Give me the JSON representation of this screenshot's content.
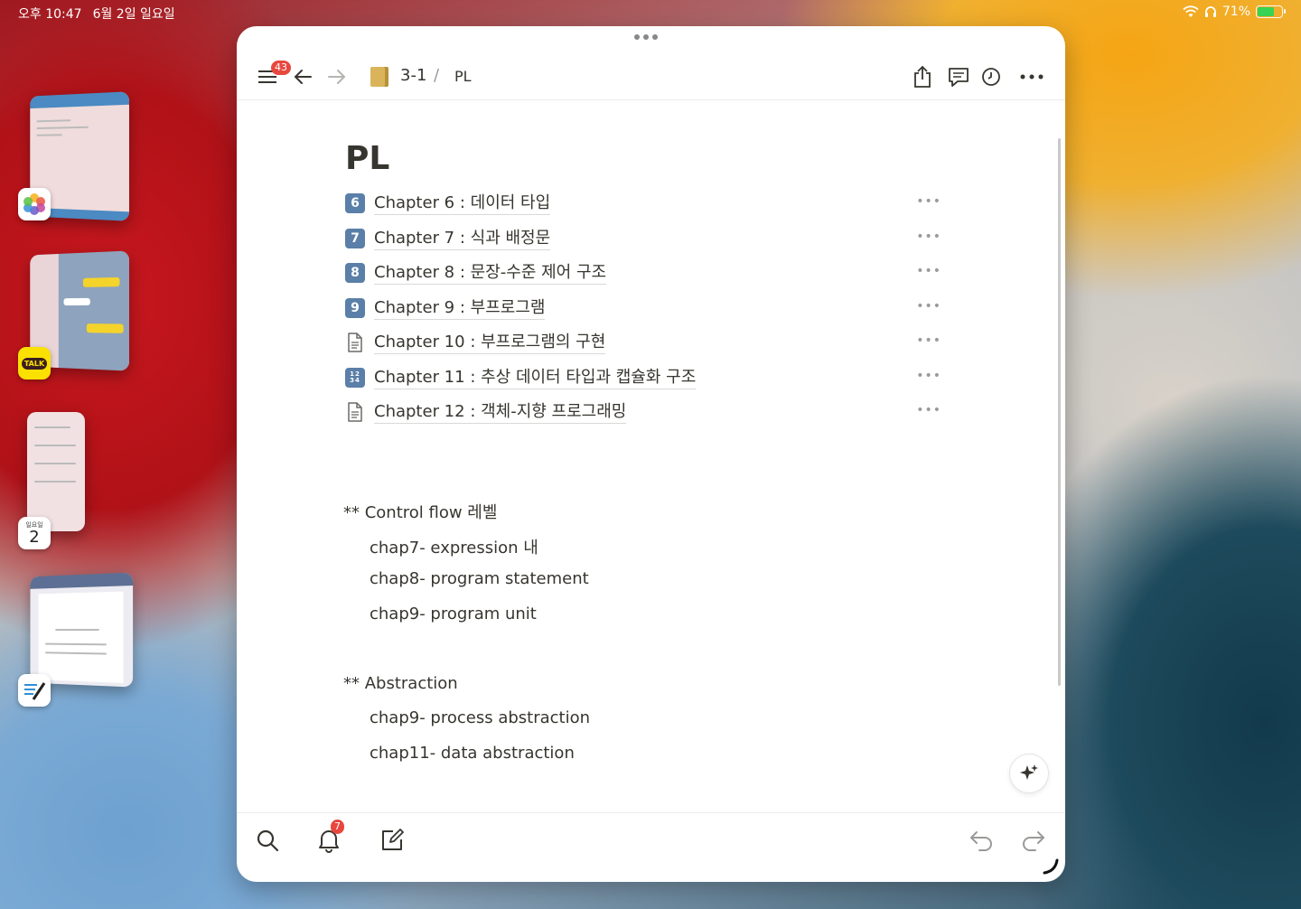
{
  "status_bar": {
    "time": "오후 10:47",
    "date": "6월 2일 일요일",
    "battery": "71%",
    "battery_level": 0.71
  },
  "slide_over": {
    "apps": [
      {
        "name": "photos-icon"
      },
      {
        "name": "kakaotalk-icon",
        "label": "TALK"
      },
      {
        "name": "calendar-icon",
        "weekday": "일요일",
        "day": "2"
      },
      {
        "name": "notes-icon"
      }
    ]
  },
  "toolbar": {
    "notifications_badge": "43",
    "breadcrumb_parent": "3-1",
    "breadcrumb_separator": "/",
    "breadcrumb_current": "PL"
  },
  "page": {
    "title": "PL",
    "links": [
      {
        "icon": "6",
        "label": "Chapter 6 : 데이터 타입",
        "type": "keycap"
      },
      {
        "icon": "7",
        "label": "Chapter 7 : 식과 배정문",
        "type": "keycap"
      },
      {
        "icon": "8",
        "label": "Chapter 8 : 문장-수준 제어 구조",
        "type": "keycap"
      },
      {
        "icon": "9",
        "label": "Chapter 9 : 부프로그램",
        "type": "keycap"
      },
      {
        "icon": "",
        "label": "Chapter 10 : 부프로그램의 구현",
        "type": "doc"
      },
      {
        "icon": "1234",
        "label": "Chapter 11 : 추상 데이터 타입과 캡슐화 구조",
        "type": "numbers"
      },
      {
        "icon": "",
        "label": "Chapter 12 : 객체-지향 프로그래밍",
        "type": "doc"
      }
    ],
    "more_glyph": "•••",
    "sections": [
      {
        "heading": "** Control flow 레벨",
        "items": [
          "chap7- expression 내",
          "chap8- program statement",
          "chap9- program unit"
        ]
      },
      {
        "heading": "** Abstraction",
        "items": [
          "chap9- process abstraction",
          "chap11- data abstraction"
        ]
      }
    ]
  },
  "bottom_bar": {
    "inbox_badge": "7"
  },
  "colors": {
    "keycap": "#5a7fa8",
    "text": "#37352f",
    "badge": "#e8473e"
  }
}
